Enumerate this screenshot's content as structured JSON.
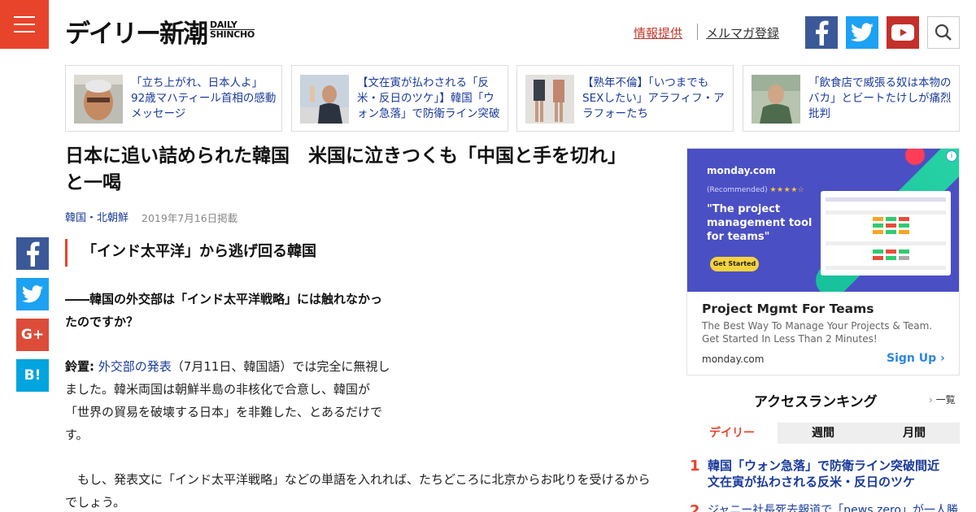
{
  "header": {
    "logo_jp": "デイリー新潮",
    "logo_en_line1": "DAILY",
    "logo_en_line2": "SHINCHO",
    "link_info": "情報提供",
    "link_mail": "メルマガ登録"
  },
  "stories": [
    {
      "text": "「立ち上がれ、日本人よ」　92歳マハティール首相の感動メッセージ"
    },
    {
      "text": "【文在寅が払わされる「反米・反日のツケ」】韓国「ウォン急落」で防衛ライン突破間近"
    },
    {
      "text": "【熟年不倫】「いつまでもSEXしたい」アラフィフ・アラフォーたち"
    },
    {
      "text": "「飲食店で威張る奴は本物のバカ」とビートたけしが痛烈批判"
    }
  ],
  "article": {
    "title": "日本に追い詰められた韓国　米国に泣きつくも「中国と手を切れ」と一喝",
    "category": "韓国・北朝鮮",
    "date": "2019年7月16日掲載",
    "h2": "「インド太平洋」から逃げ回る韓国",
    "question": "――韓国の外交部は「インド太平洋戦略」には触れなかったのですか？",
    "p1_speaker": "鈴置:",
    "p1_link": "外交部の発表",
    "p1_rest": "（7月11日、韓国語）では完全に無視しました。韓米両国は朝鮮半島の非核化で合意し、韓国が「世界の貿易を破壊する日本」を非難した、とあるだけです。",
    "p2": "もし、発表文に「インド太平洋戦略」などの単語を入れれば、たちどころに北京からお叱りを受けるからでしょう。"
  },
  "share": {
    "gplus": "G+",
    "hatena": "B!"
  },
  "ad": {
    "logo": "monday.com",
    "recommended": "(Recommended)",
    "stars": "★★★★☆",
    "quote": "\"The project management tool for teams\"",
    "cta": "Get Started",
    "info": "i",
    "headline": "Project Mgmt For Teams",
    "description": "The Best Way To Manage Your Projects & Team. Get Started In Less Than 2 Minutes!",
    "domain": "monday.com",
    "signup": "Sign Up"
  },
  "ranking": {
    "title": "アクセスランキング",
    "more": "一覧",
    "tabs": [
      "デイリー",
      "週間",
      "月間"
    ],
    "items": [
      {
        "rank": "1",
        "text": "韓国「ウォン急落」で防衛ライン突破間近　文在寅が払わされる反米・反日のツケ"
      },
      {
        "rank": "2",
        "text": "ジャニー社長死去報道で「news zero」が一人勝ち"
      }
    ]
  },
  "colors": {
    "brand_red": "#e8442c",
    "link_blue": "#1a3a9c",
    "facebook": "#3b5998",
    "twitter": "#1da1f2",
    "youtube": "#c4302b"
  }
}
